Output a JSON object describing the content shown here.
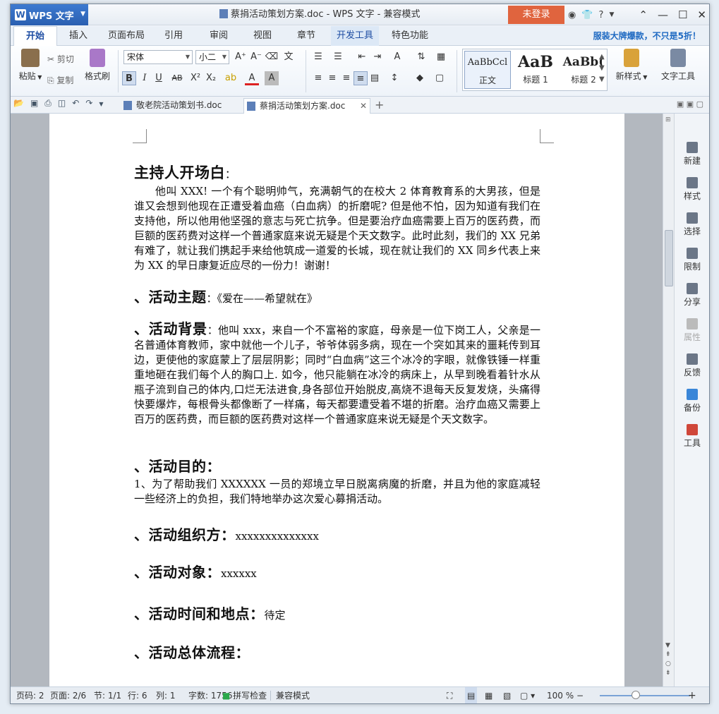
{
  "app": {
    "name": "WPS 文字",
    "window_title": "蔡捐活动策划方案.doc - WPS 文字 - 兼容模式",
    "login_label": "未登录",
    "title_icons": [
      "⚙",
      "👕",
      "?"
    ],
    "promo": "服装大牌爆款，不只是5折！"
  },
  "tabs": [
    "开始",
    "插入",
    "页面布局",
    "引用",
    "审阅",
    "视图",
    "章节",
    "开发工具",
    "特色功能"
  ],
  "ribbon": {
    "paste": "粘贴",
    "cut": "剪切",
    "copy": "复制",
    "format_painter": "格式刷",
    "font_name": "宋体",
    "font_size": "小二",
    "styles": [
      {
        "sample": "AaBbCcl",
        "name": "正文"
      },
      {
        "sample": "AaB",
        "name": "标题 1"
      },
      {
        "sample": "AaBb(",
        "name": "标题 2"
      }
    ],
    "new_style": "新样式",
    "text_tools": "文字工具"
  },
  "doc_tabs": [
    "敬老院活动策划书.doc",
    "蔡捐活动策划方案.doc"
  ],
  "document": {
    "heading_host": "主持人开场白",
    "host_colon": "：",
    "host_para": "他叫 XXX! 一个有个聪明帅气，充满朝气的在校大 2 体育教育系的大男孩，但是谁又会想到他现在正遭受着血癌（白血病）的折磨呢? 但是他不怕，因为知道有我们在支持他，所以他用他坚强的意志与死亡抗争。但是要治疗血癌需要上百万的医药费，而巨额的医药费对这样一个普通家庭来说无疑是个天文数字。此时此刻，我们的 XX 兄弟有难了，就让我们携起手来给他筑成一道爱的长城，现在就让我们的 XX 同乡代表上来为 XX 的早日康复近应尽的一份力！谢谢！",
    "h_theme": "、活动主题",
    "theme_val": "：《爱在——希望就在》",
    "h_background": "、活动背景",
    "background_para": "：他叫 xxx，来自一个不富裕的家庭，母亲是一位下岗工人，父亲是一名普通体育教师，家中就他一个儿子，爷爷体弱多病，现在一个突如其来的噩耗传到耳边，更使他的家庭蒙上了层层阴影；同时“白血病”这三个冰冷的字眼，就像铁锤一样重重地砸在我们每个人的胸口上. 如今，他只能躺在冰冷的病床上，从早到晚看着针水从瓶子流到自己的体内,口烂无法进食,身各部位开始脱皮,高烧不退每天反复发烧，头痛得快要爆炸，每根骨头都像断了一样痛，每天都要遭受着不堪的折磨。治疗血癌又需要上百万的医药费，而巨额的医药费对这样一个普通家庭来说无疑是个天文数字。",
    "h_purpose": "、活动目的：",
    "purpose_para": "1、为了帮助我们 XXXXXX 一员的郑境立早日脱离病魔的折磨，并且为他的家庭减轻一些经济上的负担，我们特地举办这次爱心募捐活动。",
    "h_organizer": "、活动组织方：",
    "organizer_val": "xxxxxxxxxxxxxx",
    "h_target": "、活动对象：",
    "target_val": "xxxxxx",
    "h_time_place": "、活动时间和地点：",
    "time_place_val": "待定",
    "h_process": "、活动总体流程："
  },
  "right_panel": [
    "新建",
    "样式",
    "选择",
    "限制",
    "分享",
    "属性",
    "反馈",
    "备份",
    "工具"
  ],
  "status": {
    "page_no": "页码: 2",
    "pages": "页面: 2/6",
    "section": "节: 1/1",
    "row": "行: 6",
    "col": "列: 1",
    "words": "字数: 1756",
    "spell": "拼写检查",
    "compat": "兼容模式",
    "zoom": "100 %"
  },
  "colors": {
    "accent": "#2a5fb0",
    "login": "#e0643e"
  }
}
